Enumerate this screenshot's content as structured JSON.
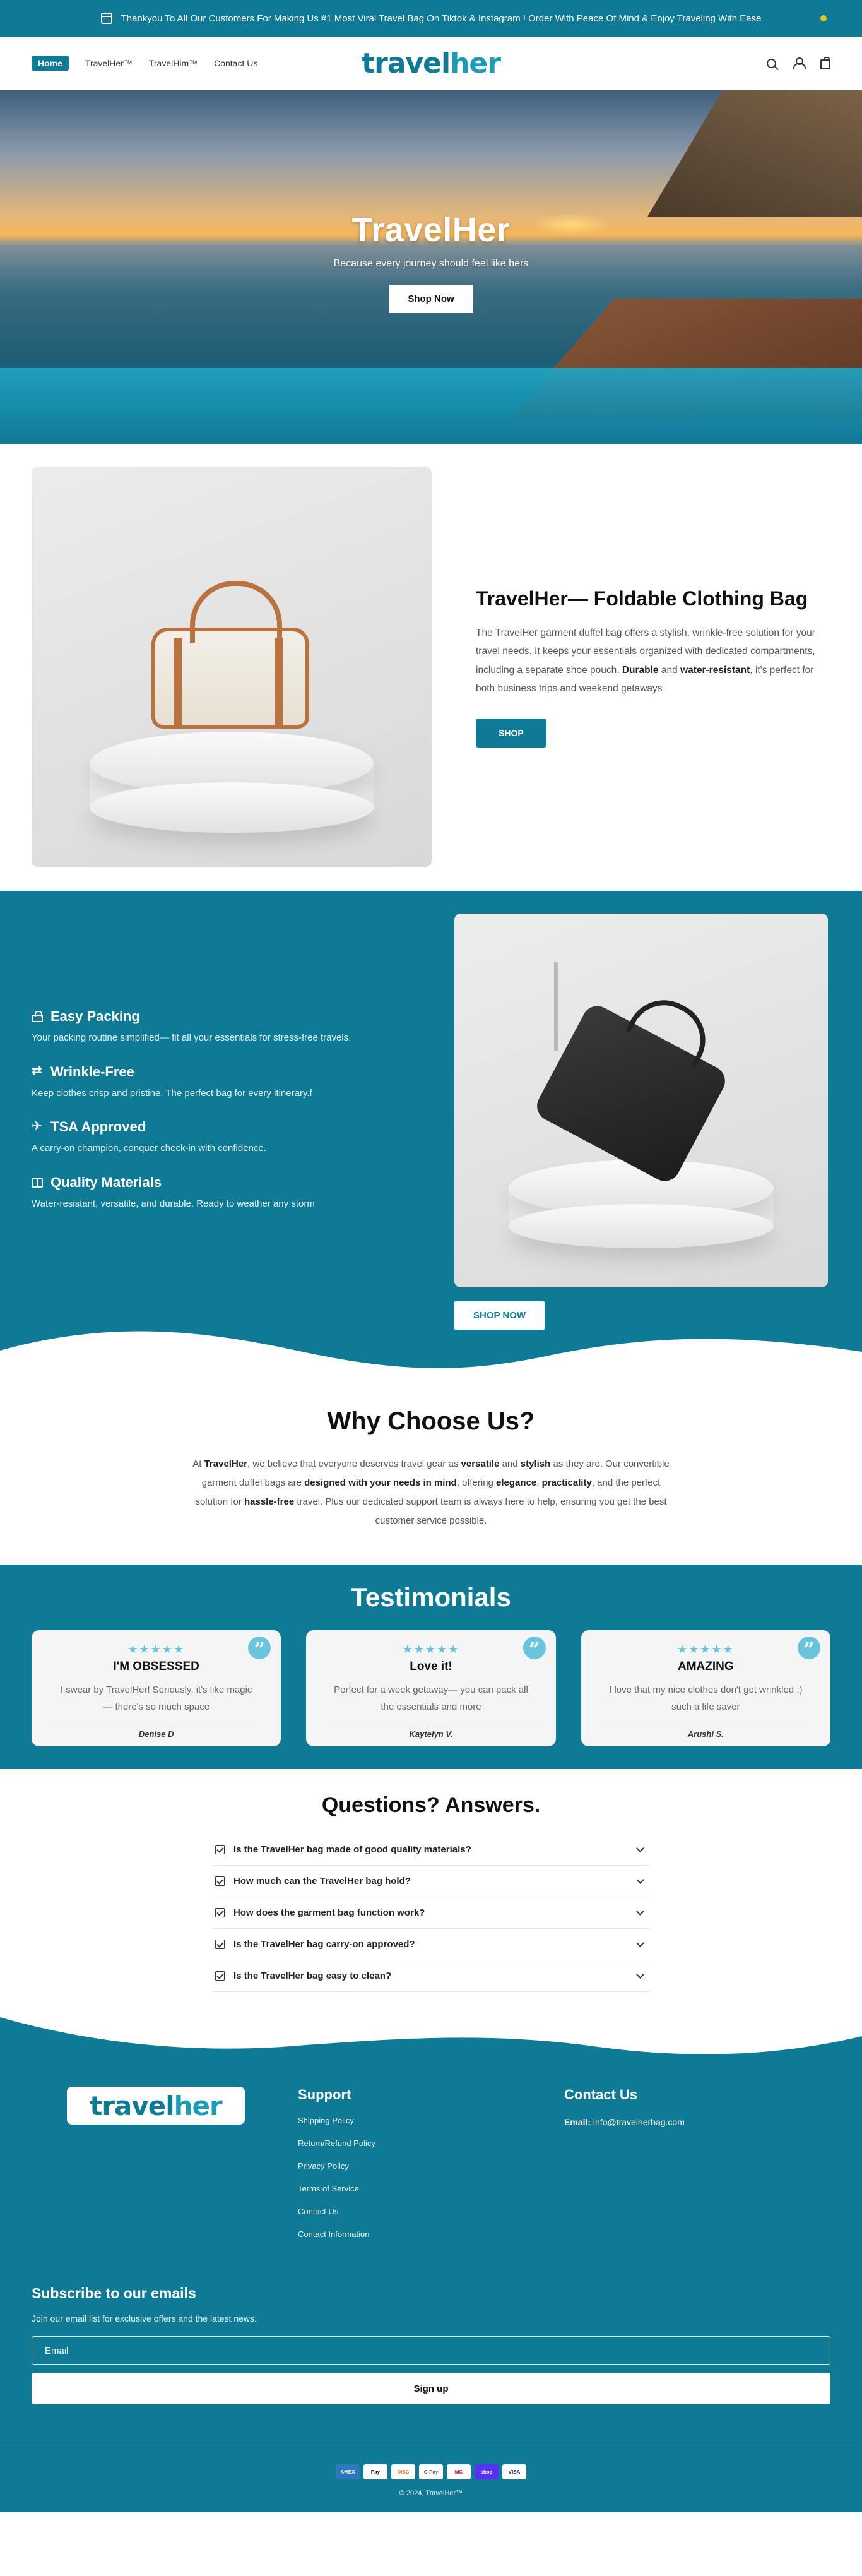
{
  "announcement": {
    "text": "Thankyou To All Our Customers For Making Us #1 Most Viral Travel Bag On Tiktok & Instagram ! Order With Peace Of Mind & Enjoy Traveling With Ease"
  },
  "header": {
    "nav": [
      "Home",
      "TravelHer™",
      "TravelHim™",
      "Contact Us"
    ],
    "logo_a": "travel",
    "logo_b": "her"
  },
  "hero": {
    "title": "TravelHer",
    "subtitle": "Because every journey should feel like hers",
    "cta": "Shop Now"
  },
  "product": {
    "title": "TravelHer— Foldable Clothing Bag",
    "desc_1": "The TravelHer garment duffel bag offers a stylish, wrinkle-free solution for your travel needs. It keeps your essentials organized with dedicated compartments, including a separate shoe pouch. ",
    "desc_b1": "Durable",
    "desc_2": " and ",
    "desc_b2": "water-resistant",
    "desc_3": ", it's perfect for both business trips and weekend getaways",
    "cta": "SHOP"
  },
  "features": {
    "items": [
      {
        "title": "Easy Packing",
        "text": "Your packing routine simplified— fit all your essentials for stress-free travels.",
        "icon": "lock-icon"
      },
      {
        "title": "Wrinkle-Free",
        "text": "Keep clothes crisp and pristine. The perfect bag for every itinerary.f",
        "icon": "arrows-icon"
      },
      {
        "title": "TSA Approved",
        "text": "A carry-on champion, conquer check-in with confidence.",
        "icon": "plane-icon"
      },
      {
        "title": "Quality Materials",
        "text": "Water-resistant, versatile, and durable. Ready to weather any storm",
        "icon": "book-icon"
      }
    ],
    "cta": "SHOP NOW"
  },
  "why": {
    "title": "Why Choose Us?",
    "parts": [
      "At ",
      "TravelHer",
      ", we believe that everyone deserves travel gear as ",
      "versatile",
      " and ",
      "stylish",
      " as they are. Our convertible garment duffel bags are ",
      "designed with your needs in mind",
      ", offering ",
      "elegance",
      ", ",
      "practicality",
      ", and the perfect solution for ",
      "hassle-free",
      " travel. Plus our dedicated support team is always here to help, ensuring you get the best customer service possible."
    ]
  },
  "testimonials": {
    "title": "Testimonials",
    "stars": "★★★★★",
    "quote_mark": "”",
    "cards": [
      {
        "title": "I'M OBSESSED",
        "quote": "I swear by TravelHer! Seriously, it's like magic— there's so much space",
        "author": "Denise D"
      },
      {
        "title": "Love it!",
        "quote": "Perfect for a week getaway— you can pack all the essentials and more",
        "author": "Kaytelyn V."
      },
      {
        "title": "AMAZING",
        "quote": "I love that my nice clothes don't get wrinkled :) such a life saver",
        "author": "Arushi S."
      }
    ]
  },
  "faq": {
    "title": "Questions? Answers.",
    "items": [
      "Is the TravelHer bag made of good quality materials?",
      "How much can the TravelHer bag hold?",
      "How does the garment bag function work?",
      "Is the TravelHer bag carry-on approved?",
      "Is the TravelHer bag easy to clean?"
    ]
  },
  "footer": {
    "logo_a": "travel",
    "logo_b": "her",
    "support_title": "Support",
    "support_links": [
      "Shipping Policy",
      "Return/Refund Policy",
      "Privacy Policy",
      "Terms of Service",
      "Contact Us",
      "Contact Information"
    ],
    "contact_title": "Contact Us",
    "email_label": "Email:",
    "email": " info@travelherbag.com",
    "subscribe_title": "Subscribe to our emails",
    "subscribe_text": "Join our email list for exclusive offers and the latest news.",
    "email_placeholder": "Email",
    "signup": "Sign up",
    "payments": [
      "AMEX",
      "Pay",
      "DISC",
      "G Pay",
      "MC",
      "shop",
      "VISA"
    ],
    "copyright": "© 2024, TravelHer™"
  },
  "colors": {
    "brand": "#0e7a96",
    "accent": "#67c6dd"
  }
}
